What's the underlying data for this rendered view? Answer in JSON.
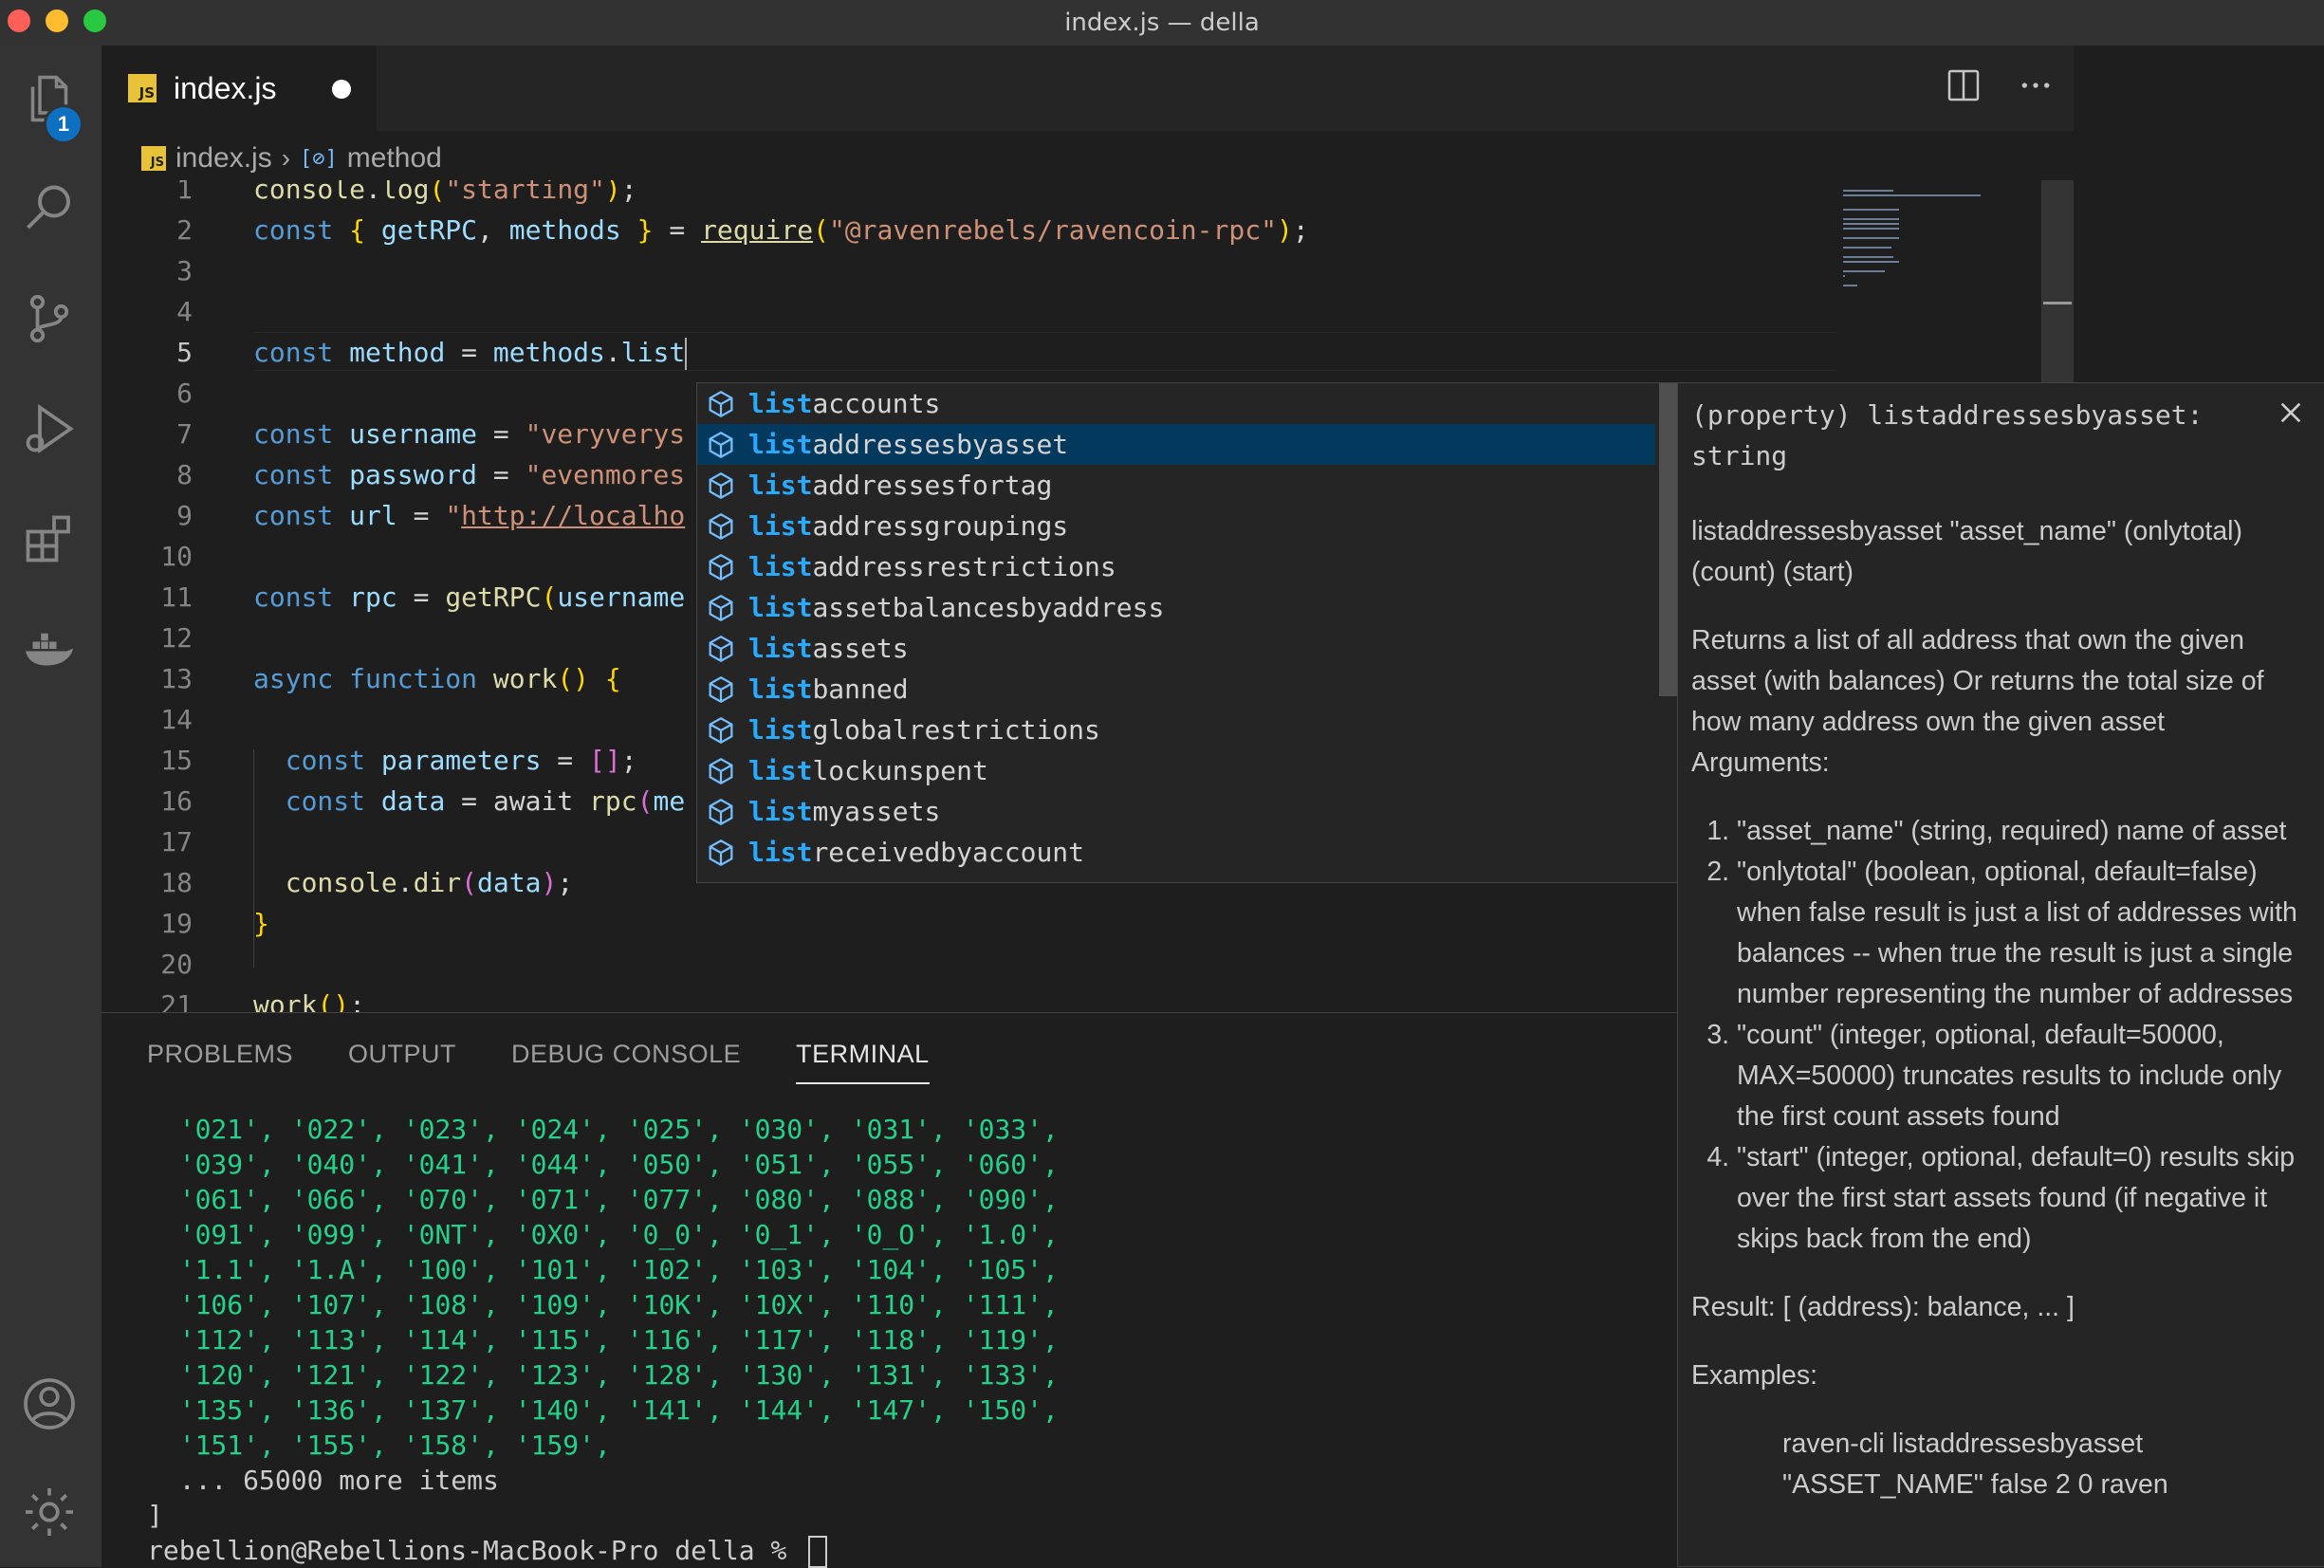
{
  "window": {
    "title": "index.js — della"
  },
  "activity_bar": {
    "icons": [
      "explorer-icon",
      "search-icon",
      "source-control-icon",
      "run-debug-icon",
      "extensions-icon",
      "docker-icon",
      "account-icon",
      "gear-icon"
    ],
    "explorer_badge": "1"
  },
  "tab": {
    "filename": "index.js",
    "js_label": "JS",
    "dirty": true
  },
  "breadcrumb": {
    "file": "index.js",
    "symbol_icon": "[⊘]",
    "symbol": "method"
  },
  "colors": {
    "accent": "#0e70c0",
    "selection": "#04395e",
    "highlight": "#2aaaff",
    "terminal_green": "#23d18b"
  },
  "code": {
    "active_line": 5,
    "lines": [
      {
        "n": "1",
        "tokens": [
          [
            "f",
            "console"
          ],
          [
            "o",
            "."
          ],
          [
            "f",
            "log"
          ],
          [
            "y",
            "("
          ],
          [
            "s",
            "\"starting\""
          ],
          [
            "y",
            ")"
          ],
          [
            "o",
            ";"
          ]
        ]
      },
      {
        "n": "2",
        "tokens": [
          [
            "k",
            "const"
          ],
          [
            "o",
            " "
          ],
          [
            "y",
            "{"
          ],
          [
            "o",
            " "
          ],
          [
            "v",
            "getRPC"
          ],
          [
            "o",
            ", "
          ],
          [
            "v",
            "methods"
          ],
          [
            "o",
            " "
          ],
          [
            "y",
            "}"
          ],
          [
            "o",
            " = "
          ],
          [
            "fu",
            "require"
          ],
          [
            "y",
            "("
          ],
          [
            "s",
            "\"@ravenrebels/ravencoin-rpc\""
          ],
          [
            "y",
            ")"
          ],
          [
            "o",
            ";"
          ]
        ]
      },
      {
        "n": "3",
        "tokens": []
      },
      {
        "n": "4",
        "tokens": []
      },
      {
        "n": "5",
        "tokens": [
          [
            "k",
            "const"
          ],
          [
            "o",
            " "
          ],
          [
            "v",
            "method"
          ],
          [
            "o",
            " = "
          ],
          [
            "v",
            "methods"
          ],
          [
            "o",
            "."
          ],
          [
            "v",
            "list"
          ]
        ]
      },
      {
        "n": "6",
        "tokens": []
      },
      {
        "n": "7",
        "tokens": [
          [
            "k",
            "const"
          ],
          [
            "o",
            " "
          ],
          [
            "v",
            "username"
          ],
          [
            "o",
            " = "
          ],
          [
            "s",
            "\"veryverys"
          ]
        ]
      },
      {
        "n": "8",
        "tokens": [
          [
            "k",
            "const"
          ],
          [
            "o",
            " "
          ],
          [
            "v",
            "password"
          ],
          [
            "o",
            " = "
          ],
          [
            "s",
            "\"evenmores"
          ]
        ]
      },
      {
        "n": "9",
        "tokens": [
          [
            "k",
            "const"
          ],
          [
            "o",
            " "
          ],
          [
            "v",
            "url"
          ],
          [
            "o",
            " = "
          ],
          [
            "s",
            "\""
          ],
          [
            "su",
            "http://localho"
          ]
        ]
      },
      {
        "n": "10",
        "tokens": []
      },
      {
        "n": "11",
        "tokens": [
          [
            "k",
            "const"
          ],
          [
            "o",
            " "
          ],
          [
            "v",
            "rpc"
          ],
          [
            "o",
            " = "
          ],
          [
            "f",
            "getRPC"
          ],
          [
            "y",
            "("
          ],
          [
            "v",
            "username"
          ]
        ]
      },
      {
        "n": "12",
        "tokens": []
      },
      {
        "n": "13",
        "tokens": [
          [
            "k",
            "async"
          ],
          [
            "o",
            " "
          ],
          [
            "k",
            "function"
          ],
          [
            "o",
            " "
          ],
          [
            "f",
            "work"
          ],
          [
            "y",
            "()"
          ],
          [
            "o",
            " "
          ],
          [
            "y",
            "{"
          ]
        ]
      },
      {
        "n": "14",
        "tokens": []
      },
      {
        "n": "15",
        "tokens": [
          [
            "o",
            "  "
          ],
          [
            "k",
            "const"
          ],
          [
            "o",
            " "
          ],
          [
            "v",
            "parameters"
          ],
          [
            "o",
            " = "
          ],
          [
            "p",
            "[]"
          ],
          [
            "o",
            ";"
          ]
        ]
      },
      {
        "n": "16",
        "tokens": [
          [
            "o",
            "  "
          ],
          [
            "k",
            "const"
          ],
          [
            "o",
            " "
          ],
          [
            "v",
            "data"
          ],
          [
            "o",
            " = "
          ],
          [
            "o",
            "await "
          ],
          [
            "f",
            "rpc"
          ],
          [
            "p",
            "("
          ],
          [
            "v",
            "me"
          ]
        ]
      },
      {
        "n": "17",
        "tokens": []
      },
      {
        "n": "18",
        "tokens": [
          [
            "o",
            "  "
          ],
          [
            "f",
            "console"
          ],
          [
            "o",
            "."
          ],
          [
            "f",
            "dir"
          ],
          [
            "p",
            "("
          ],
          [
            "v",
            "data"
          ],
          [
            "p",
            ")"
          ],
          [
            "o",
            ";"
          ]
        ]
      },
      {
        "n": "19",
        "tokens": [
          [
            "y",
            "}"
          ]
        ]
      },
      {
        "n": "20",
        "tokens": []
      },
      {
        "n": "21",
        "tokens": [
          [
            "f",
            "work"
          ],
          [
            "y",
            "()"
          ],
          [
            "o",
            ";"
          ]
        ]
      }
    ]
  },
  "suggest": {
    "prefix": "list",
    "selected_index": 1,
    "items": [
      "accounts",
      "addressesbyasset",
      "addressesfortag",
      "addressgroupings",
      "addressrestrictions",
      "assetbalancesbyaddress",
      "assets",
      "banned",
      "globalrestrictions",
      "lockunspent",
      "myassets",
      "receivedbyaccount"
    ]
  },
  "details": {
    "signature": "(property) listaddressesbyasset: string",
    "usage": "listaddressesbyasset \"asset_name\" (onlytotal) (count) (start)",
    "description": "Returns a list of all address that own the given asset (with balances) Or returns the total size of how many address own the given asset",
    "args_label": "Arguments:",
    "args": [
      "\"asset_name\" (string, required) name of asset",
      "\"onlytotal\" (boolean, optional, default=false) when false result is just a list of addresses with balances -- when true the result is just a single number representing the number of addresses",
      "\"count\" (integer, optional, default=50000, MAX=50000) truncates results to include only the first count assets found",
      "\"start\" (integer, optional, default=0) results skip over the first start assets found (if negative it skips back from the end)"
    ],
    "result": "Result: [ (address): balance, ... ]",
    "examples_label": "Examples:",
    "example": "raven-cli listaddressesbyasset \"ASSET_NAME\" false 2 0 raven"
  },
  "panel": {
    "tabs": [
      "PROBLEMS",
      "OUTPUT",
      "DEBUG CONSOLE",
      "TERMINAL"
    ],
    "active_tab": 3,
    "terminal_lines": [
      [
        "  ",
        "'021', '022', '023', '024', '025', '030', '031', '033',"
      ],
      [
        "  ",
        "'039', '040', '041', '044', '050', '051', '055', '060',"
      ],
      [
        "  ",
        "'061', '066', '070', '071', '077', '080', '088', '090',"
      ],
      [
        "  ",
        "'091', '099', '0NT', '0X0', '0_0', '0_1', '0_O', '1.0',"
      ],
      [
        "  ",
        "'1.1', '1.A', '100', '101', '102', '103', '104', '105',"
      ],
      [
        "  ",
        "'106', '107', '108', '109', '10K', '10X', '110', '111',"
      ],
      [
        "  ",
        "'112', '113', '114', '115', '116', '117', '118', '119',"
      ],
      [
        "  ",
        "'120', '121', '122', '123', '128', '130', '131', '133',"
      ],
      [
        "  ",
        "'135', '136', '137', '140', '141', '144', '147', '150',"
      ],
      [
        "  ",
        "'151', '155', '158', '159',"
      ]
    ],
    "more_items": "  ... 65000 more items",
    "close_bracket": "]",
    "prompt": "rebellion@Rebellions-MacBook-Pro della % "
  }
}
